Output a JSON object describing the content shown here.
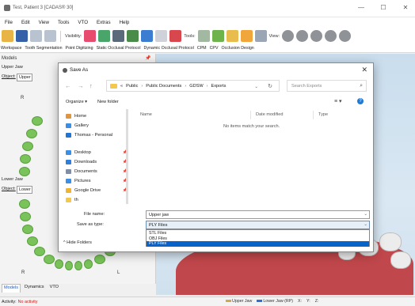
{
  "window": {
    "title": "Test, Patient 3 [CADAS® 30]",
    "controls": [
      "—",
      "☐",
      "✕"
    ]
  },
  "menu": [
    "File",
    "Edit",
    "View",
    "Tools",
    "VTO",
    "Extras",
    "Help"
  ],
  "toolbar": {
    "visibility_label": "Visibility:",
    "tools_label": "Tools:",
    "view_label": "View:"
  },
  "modules": [
    "Workspace",
    "Tooth Segmentation",
    "Point Digitizing",
    "Static Occlusal Protocol",
    "Dynamic Occlusal Protocol",
    "CPM",
    "CPV",
    "Occlusion Design"
  ],
  "left_panel": {
    "title": "Models",
    "pin": "📌",
    "upper_jaw": "Upper Jaw",
    "lower_jaw": "Lower Jaw",
    "object_label": "Object:",
    "upper_object_value": "Upper j",
    "lower_object_value": "Lower j",
    "side_r": "R",
    "side_l": "L",
    "tabs": [
      "Models",
      "Dynamics",
      "VTO"
    ]
  },
  "status": {
    "activity_label": "Activity:",
    "activity_value": "No activity",
    "upper_jaw": "Upper Jaw",
    "lower_jaw": "Lower Jaw (RP)",
    "x_label": "X:",
    "y_label": "Y:",
    "z_label": "Z:",
    "upper_color": "#d4a84a",
    "lower_color": "#2e6fcf"
  },
  "dialog": {
    "title": "Save As",
    "close": "✕",
    "nav": {
      "back": "←",
      "forward": "→",
      "up": "↑"
    },
    "path": [
      "«",
      "Public",
      "Public Documents",
      "GDSW",
      "Exports"
    ],
    "path_dropdown": "⌄",
    "refresh": "↻",
    "search_placeholder": "Search Exports",
    "search_icon": "⌕",
    "organize": "Organize ▾",
    "new_folder": "New folder",
    "view_icon": "≡ ▾",
    "help_icon": "?",
    "nav_items": [
      {
        "label": "Home",
        "icon": "home-icon",
        "color": "#e1953f",
        "pinned": false
      },
      {
        "label": "Gallery",
        "icon": "gallery-icon",
        "color": "#3a8ee6",
        "pinned": false
      },
      {
        "label": "Thomas - Personal",
        "icon": "cloud-icon",
        "color": "#1f74d4",
        "pinned": false
      },
      {
        "label": "Desktop",
        "icon": "desktop-icon",
        "color": "#3a8ee6",
        "pinned": true
      },
      {
        "label": "Downloads",
        "icon": "download-icon",
        "color": "#2e7fd9",
        "pinned": true
      },
      {
        "label": "Documents",
        "icon": "documents-icon",
        "color": "#7d8ea8",
        "pinned": true
      },
      {
        "label": "Pictures",
        "icon": "pictures-icon",
        "color": "#3a8ee6",
        "pinned": true
      },
      {
        "label": "Google Drive",
        "icon": "google-drive-icon",
        "color": "#f0b430",
        "pinned": true
      },
      {
        "label": "th",
        "icon": "folder-icon",
        "color": "#f2c94c",
        "pinned": false
      }
    ],
    "pin_glyph": "📌",
    "columns": [
      "Name",
      "Date modified",
      "Type"
    ],
    "empty_message": "No items match your search.",
    "file_name_label": "File name:",
    "file_name_value": "Upper jaw",
    "save_type_label": "Save as type:",
    "save_type_value": "PLY Files",
    "file_types": [
      "STL Files",
      "OBJ Files",
      "PLY Files"
    ],
    "selected_type": "PLY Files",
    "hide_folders": "^ Hide Folders"
  }
}
